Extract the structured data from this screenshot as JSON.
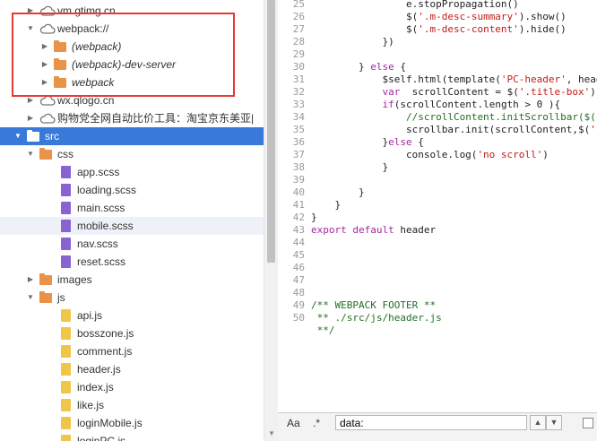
{
  "tree": {
    "rows": [
      {
        "label": "vm.gtimg.cn",
        "indent": 1,
        "arrow": "▶",
        "icon": "cloud",
        "state": "normal"
      },
      {
        "label": "webpack://",
        "indent": 1,
        "arrow": "▼",
        "icon": "cloud",
        "state": "normal"
      },
      {
        "label": "(webpack)",
        "indent": 2,
        "arrow": "▶",
        "icon": "folder",
        "state": "normal",
        "italic": true
      },
      {
        "label": "(webpack)-dev-server",
        "indent": 2,
        "arrow": "▶",
        "icon": "folder",
        "state": "normal",
        "italic": true
      },
      {
        "label": "webpack",
        "indent": 2,
        "arrow": "▶",
        "icon": "folder",
        "state": "normal",
        "italic": true
      },
      {
        "label": "wx.qlogo.cn",
        "indent": 1,
        "arrow": "▶",
        "icon": "cloud",
        "state": "normal"
      },
      {
        "label": "购物党全网自动比价工具：淘宝京东美亚|",
        "indent": 1,
        "arrow": "▶",
        "icon": "cloud",
        "state": "normal"
      },
      {
        "label": "src",
        "indent": 0,
        "arrow": "▼",
        "icon": "folder",
        "state": "selected"
      },
      {
        "label": "css",
        "indent": 1,
        "arrow": "▼",
        "icon": "folder",
        "state": "normal"
      },
      {
        "label": "app.scss",
        "indent": 2,
        "arrow": "",
        "icon": "scss",
        "state": "normal"
      },
      {
        "label": "loading.scss",
        "indent": 2,
        "arrow": "",
        "icon": "scss",
        "state": "normal"
      },
      {
        "label": "main.scss",
        "indent": 2,
        "arrow": "",
        "icon": "scss",
        "state": "normal"
      },
      {
        "label": "mobile.scss",
        "indent": 2,
        "arrow": "",
        "icon": "scss",
        "state": "hover"
      },
      {
        "label": "nav.scss",
        "indent": 2,
        "arrow": "",
        "icon": "scss",
        "state": "normal"
      },
      {
        "label": "reset.scss",
        "indent": 2,
        "arrow": "",
        "icon": "scss",
        "state": "normal"
      },
      {
        "label": "images",
        "indent": 1,
        "arrow": "▶",
        "icon": "folder",
        "state": "normal"
      },
      {
        "label": "js",
        "indent": 1,
        "arrow": "▼",
        "icon": "folder",
        "state": "normal"
      },
      {
        "label": "api.js",
        "indent": 2,
        "arrow": "",
        "icon": "js",
        "state": "normal"
      },
      {
        "label": "bosszone.js",
        "indent": 2,
        "arrow": "",
        "icon": "js",
        "state": "normal"
      },
      {
        "label": "comment.js",
        "indent": 2,
        "arrow": "",
        "icon": "js",
        "state": "normal"
      },
      {
        "label": "header.js",
        "indent": 2,
        "arrow": "",
        "icon": "js",
        "state": "normal"
      },
      {
        "label": "index.js",
        "indent": 2,
        "arrow": "",
        "icon": "js",
        "state": "normal"
      },
      {
        "label": "like.js",
        "indent": 2,
        "arrow": "",
        "icon": "js",
        "state": "normal"
      },
      {
        "label": "loginMobile.js",
        "indent": 2,
        "arrow": "",
        "icon": "js",
        "state": "normal"
      },
      {
        "label": "loginPC.js",
        "indent": 2,
        "arrow": "",
        "icon": "js",
        "state": "normal"
      }
    ]
  },
  "editor": {
    "lines": [
      {
        "n": "25",
        "code": [
          {
            "t": "                e.stopPropagation()",
            "c": ""
          }
        ]
      },
      {
        "n": "26",
        "code": [
          {
            "t": "                $(",
            "c": ""
          },
          {
            "t": "'.m-desc-summary'",
            "c": "str"
          },
          {
            "t": ").show()",
            "c": ""
          }
        ]
      },
      {
        "n": "27",
        "code": [
          {
            "t": "                $(",
            "c": ""
          },
          {
            "t": "'.m-desc-content'",
            "c": "str"
          },
          {
            "t": ").hide()",
            "c": ""
          }
        ]
      },
      {
        "n": "28",
        "code": [
          {
            "t": "            })",
            "c": ""
          }
        ]
      },
      {
        "n": "29",
        "code": [
          {
            "t": "",
            "c": ""
          }
        ]
      },
      {
        "n": "30",
        "code": [
          {
            "t": "        } ",
            "c": ""
          },
          {
            "t": "else",
            "c": "kw"
          },
          {
            "t": " {",
            "c": ""
          }
        ]
      },
      {
        "n": "31",
        "code": [
          {
            "t": "            $self.html(template(",
            "c": ""
          },
          {
            "t": "'PC-header'",
            "c": "str"
          },
          {
            "t": ", head",
            "c": ""
          }
        ]
      },
      {
        "n": "32",
        "code": [
          {
            "t": "            ",
            "c": ""
          },
          {
            "t": "var",
            "c": "kw"
          },
          {
            "t": "  scrollContent = $(",
            "c": ""
          },
          {
            "t": "'.title-box'",
            "c": "str"
          },
          {
            "t": ")",
            "c": ""
          }
        ]
      },
      {
        "n": "33",
        "code": [
          {
            "t": "            ",
            "c": ""
          },
          {
            "t": "if",
            "c": "kw"
          },
          {
            "t": "(scrollContent.length > 0 ){",
            "c": ""
          }
        ]
      },
      {
        "n": "34",
        "code": [
          {
            "t": "                ",
            "c": ""
          },
          {
            "t": "//scrollContent.initScrollbar($(",
            "c": "cm"
          }
        ]
      },
      {
        "n": "35",
        "code": [
          {
            "t": "                scrollbar.init(scrollContent,$(",
            "c": ""
          },
          {
            "t": "'",
            "c": "str"
          }
        ]
      },
      {
        "n": "36",
        "code": [
          {
            "t": "            }",
            "c": ""
          },
          {
            "t": "else",
            "c": "kw"
          },
          {
            "t": " {",
            "c": ""
          }
        ]
      },
      {
        "n": "37",
        "code": [
          {
            "t": "                console.log(",
            "c": ""
          },
          {
            "t": "'no scroll'",
            "c": "str"
          },
          {
            "t": ")",
            "c": ""
          }
        ]
      },
      {
        "n": "38",
        "code": [
          {
            "t": "            }",
            "c": ""
          }
        ]
      },
      {
        "n": "39",
        "code": [
          {
            "t": "",
            "c": ""
          }
        ]
      },
      {
        "n": "40",
        "code": [
          {
            "t": "        }",
            "c": ""
          }
        ]
      },
      {
        "n": "41",
        "code": [
          {
            "t": "    }",
            "c": ""
          }
        ]
      },
      {
        "n": "42",
        "code": [
          {
            "t": "}",
            "c": ""
          }
        ]
      },
      {
        "n": "43",
        "code": [
          {
            "t": "export",
            "c": "kw"
          },
          {
            "t": " ",
            "c": ""
          },
          {
            "t": "default",
            "c": "kw"
          },
          {
            "t": " header",
            "c": ""
          }
        ]
      },
      {
        "n": "44",
        "code": [
          {
            "t": "",
            "c": ""
          }
        ]
      },
      {
        "n": "45",
        "code": [
          {
            "t": "",
            "c": ""
          }
        ]
      },
      {
        "n": "46",
        "code": [
          {
            "t": "",
            "c": ""
          }
        ]
      },
      {
        "n": "47",
        "code": [
          {
            "t": "",
            "c": ""
          }
        ]
      },
      {
        "n": "48",
        "code": [
          {
            "t": "",
            "c": ""
          }
        ]
      },
      {
        "n": "49",
        "code": [
          {
            "t": "/** WEBPACK FOOTER **",
            "c": "cm"
          }
        ]
      },
      {
        "n": "50",
        "code": [
          {
            "t": " ** ./src/js/header.js",
            "c": "cm"
          }
        ]
      },
      {
        "n": "",
        "code": [
          {
            "t": " **/",
            "c": "cm"
          }
        ]
      }
    ]
  },
  "search": {
    "case_label": "Aa",
    "regex_label": ".*",
    "value": "data:",
    "up_icon": "chevron-up-icon",
    "down_icon": "chevron-down-icon"
  }
}
